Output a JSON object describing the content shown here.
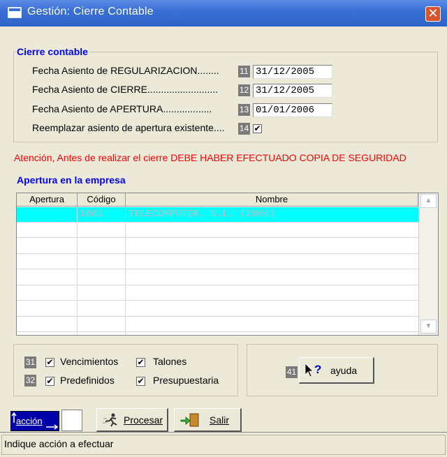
{
  "window": {
    "title": "Gestión: Cierre Contable",
    "close_glyph": "✕"
  },
  "cierre": {
    "legend": "Cierre contable",
    "rows": [
      {
        "label": "Fecha Asiento de REGULARIZACION........",
        "num": "11",
        "value": "31/12/2005"
      },
      {
        "label": "Fecha Asiento de CIERRE..........................",
        "num": "12",
        "value": "31/12/2005"
      },
      {
        "label": "Fecha Asiento de APERTURA..................",
        "num": "13",
        "value": "01/01/2006"
      }
    ],
    "reemplazar": {
      "label": "Reemplazar asiento de apertura existente....",
      "num": "14",
      "checked": "✔"
    }
  },
  "warning": "Atención, Antes de realizar el cierre DEBE HABER EFECTUADO COPIA DE SEGURIDAD",
  "apertura": {
    "legend": "Apertura en la empresa",
    "columns": [
      "Apertura",
      "Código",
      "Nombre"
    ],
    "selected_row": {
      "apertura": "",
      "codigo": "1001",
      "nombre": "TELECOMPUTER, S.L. (2006)"
    }
  },
  "options": {
    "vencimientos": {
      "num": "31",
      "label": "Vencimientos",
      "checked": "✔"
    },
    "talones": {
      "label": "Talones",
      "checked": "✔"
    },
    "predefinidos": {
      "num": "32",
      "label": "Predefinidos",
      "checked": "✔"
    },
    "presupuestaria": {
      "label": "Presupuestaria",
      "checked": "✔"
    }
  },
  "ayuda": {
    "num": "41",
    "label": "ayuda"
  },
  "toolbar": {
    "accion_label": "acción",
    "procesar_label": "Procesar",
    "salir_label": "Salir"
  },
  "status": "Indique acción a efectuar",
  "colors": {
    "accent": "#0000ff",
    "warning": "#ff0000",
    "selection": "#00ffff",
    "titlebar": "#3a70d6",
    "face": "#ECE9D8"
  }
}
